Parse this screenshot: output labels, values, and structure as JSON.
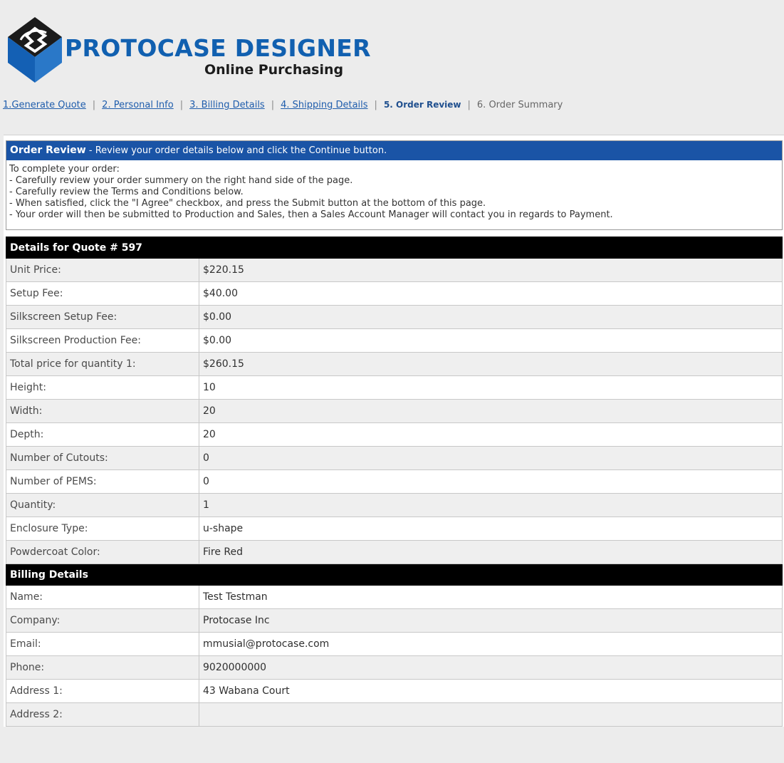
{
  "brand": {
    "title": "PROTOCASE DESIGNER",
    "subtitle": "Online Purchasing"
  },
  "steps": [
    {
      "label": "1.Generate Quote",
      "state": "link"
    },
    {
      "label": "2. Personal Info",
      "state": "link"
    },
    {
      "label": "3. Billing Details",
      "state": "link"
    },
    {
      "label": "4. Shipping Details",
      "state": "link"
    },
    {
      "label": "5. Order Review",
      "state": "current"
    },
    {
      "label": "6. Order Summary",
      "state": "future"
    }
  ],
  "review": {
    "heading": "Order Review",
    "heading_note": " - Review your order details below and click the Continue button.",
    "lines": [
      "To complete your order:",
      "- Carefully review your order summery on the right hand side of the page.",
      "- Carefully review the Terms and Conditions below.",
      "- When satisfied, click the \"I Agree\" checkbox, and press the Submit button at the bottom of this page.",
      "- Your order will then be submitted to Production and Sales, then a Sales Account Manager will contact you in regards to Payment."
    ]
  },
  "quote": {
    "title": "Details for Quote # 597",
    "rows": [
      {
        "label": "Unit Price:",
        "value": "$220.15"
      },
      {
        "label": "Setup Fee:",
        "value": "$40.00"
      },
      {
        "label": "Silkscreen Setup Fee:",
        "value": "$0.00"
      },
      {
        "label": "Silkscreen Production Fee:",
        "value": "$0.00"
      },
      {
        "label": "Total price for quantity 1:",
        "value": "$260.15"
      },
      {
        "label": "Height:",
        "value": "10"
      },
      {
        "label": "Width:",
        "value": "20"
      },
      {
        "label": "Depth:",
        "value": "20"
      },
      {
        "label": "Number of Cutouts:",
        "value": "0"
      },
      {
        "label": "Number of PEMS:",
        "value": "0"
      },
      {
        "label": "Quantity:",
        "value": "1"
      },
      {
        "label": "Enclosure Type:",
        "value": "u-shape"
      },
      {
        "label": "Powdercoat Color:",
        "value": "Fire Red"
      }
    ]
  },
  "billing": {
    "title": "Billing Details",
    "rows": [
      {
        "label": "Name:",
        "value": "Test Testman"
      },
      {
        "label": "Company:",
        "value": "Protocase Inc"
      },
      {
        "label": "Email:",
        "value": "mmusial@protocase.com"
      },
      {
        "label": "Phone:",
        "value": "9020000000"
      },
      {
        "label": "Address 1:",
        "value": "43 Wabana Court"
      },
      {
        "label": "Address 2:",
        "value": ""
      }
    ]
  },
  "colors": {
    "brand_blue": "#1160b0",
    "header_bar": "#1a54a6",
    "section_bar": "#000000"
  }
}
